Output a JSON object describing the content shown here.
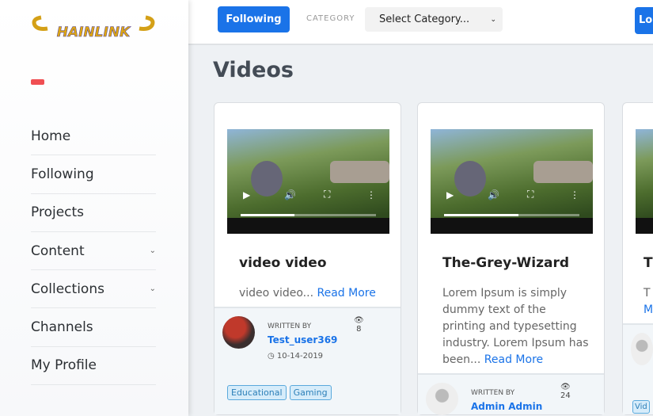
{
  "sidebar": {
    "logo_text": "CHAINLINK",
    "items": [
      {
        "label": "Home"
      },
      {
        "label": "Following"
      },
      {
        "label": "Projects"
      },
      {
        "label": "Content",
        "has_submenu": true
      },
      {
        "label": "Collections",
        "has_submenu": true
      },
      {
        "label": "Channels"
      },
      {
        "label": "My Profile"
      }
    ]
  },
  "topbar": {
    "following_label": "Following",
    "category_label": "CATEGORY",
    "category_value": "Select Category...",
    "right_button_label": "Lo"
  },
  "page_title": "Videos",
  "cards": [
    {
      "title": "video video",
      "excerpt": "video video...",
      "read_more": "Read More",
      "written_by": "WRITTEN BY",
      "author": "Test_user369",
      "date": "10-14-2019",
      "views": "8",
      "tags": [
        "Educational",
        "Gaming"
      ],
      "progress": 0.4
    },
    {
      "title": "The-Grey-Wizard",
      "excerpt": "Lorem Ipsum is simply dummy text of the printing and typesetting industry. Lorem Ipsum has been...",
      "read_more": "Read More",
      "written_by": "WRITTEN BY",
      "author": "Admin Admin",
      "views": "24",
      "progress": 0.55
    },
    {
      "title": "T",
      "excerpt": "T",
      "read_more": "M",
      "tags": [
        "Vid"
      ]
    }
  ]
}
